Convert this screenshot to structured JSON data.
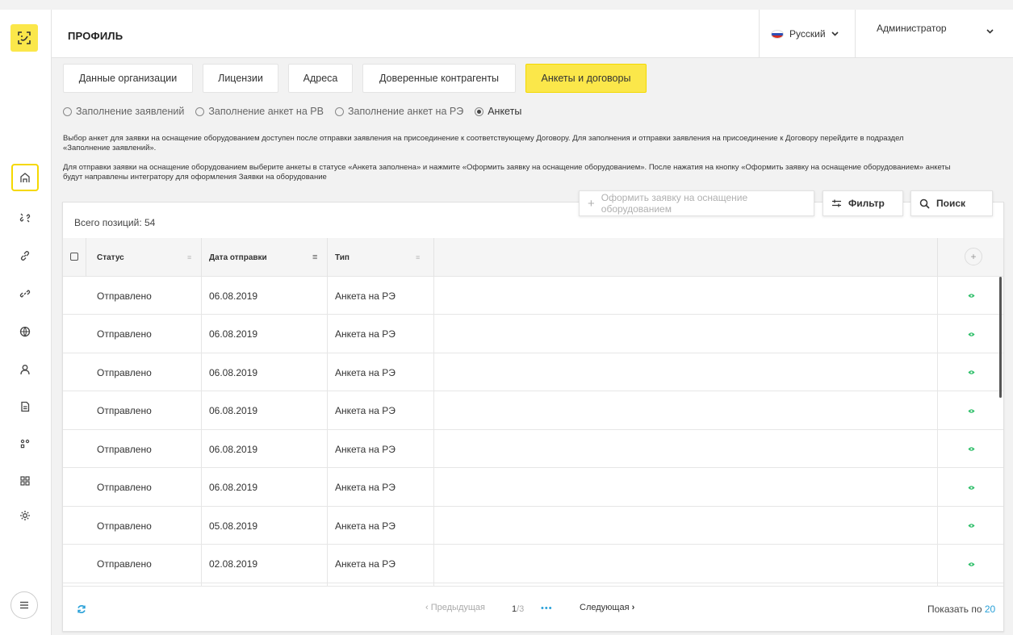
{
  "sidebar": {
    "nav": [
      {
        "name": "home-icon",
        "active": true
      },
      {
        "name": "link-broken-icon"
      },
      {
        "name": "link-icon"
      },
      {
        "name": "link-broken-2-icon"
      },
      {
        "name": "globe-icon"
      },
      {
        "name": "user-icon"
      },
      {
        "name": "document-icon"
      },
      {
        "name": "apps-icon"
      },
      {
        "name": "grid-icon"
      },
      {
        "name": "settings-icon"
      }
    ]
  },
  "header": {
    "title": "ПРОФИЛЬ",
    "language": "Русский",
    "user": "Администратор"
  },
  "tabs": [
    {
      "label": "Данные организации",
      "active": false
    },
    {
      "label": "Лицензии",
      "active": false
    },
    {
      "label": "Адреса",
      "active": false
    },
    {
      "label": "Доверенные контрагенты",
      "active": false
    },
    {
      "label": "Анкеты и договоры",
      "active": true
    }
  ],
  "radios": [
    {
      "label": "Заполнение заявлений",
      "checked": false
    },
    {
      "label": "Заполнение анкет на РВ",
      "checked": false
    },
    {
      "label": "Заполнение анкет на РЭ",
      "checked": false
    },
    {
      "label": "Анкеты",
      "checked": true
    }
  ],
  "info": {
    "line1a": "Выбор анкет для заявки на оснащение оборудованием доступен после отправки заявления на присоединение к соответствующему Договору. Для заполнения и отправки заявления на присоединение к Договору перейдите в подраздел",
    "line1b": "«Заполнение заявлений».",
    "line2a": "Для отправки заявки на оснащение оборудованием выберите анкеты в статусе «Анкета заполнена» и нажмите «Оформить заявку на оснащение оборудованием». После нажатия на кнопку «Оформить заявку на оснащение оборудованием» анкеты",
    "line2b": "будут направлены интегратору для оформления Заявки на оборудование"
  },
  "toolbar": {
    "submit_label": "Оформить заявку на оснащение оборудованием",
    "filter_label": "Фильтр",
    "search_label": "Поиск"
  },
  "table": {
    "total": "Всего позиций: 54",
    "columns": [
      "Статус",
      "Дата отправки",
      "Тип"
    ],
    "rows": [
      [
        "Отправлено",
        "06.08.2019",
        "Анкета на РЭ"
      ],
      [
        "Отправлено",
        "06.08.2019",
        "Анкета на РЭ"
      ],
      [
        "Отправлено",
        "06.08.2019",
        "Анкета на РЭ"
      ],
      [
        "Отправлено",
        "06.08.2019",
        "Анкета на РЭ"
      ],
      [
        "Отправлено",
        "06.08.2019",
        "Анкета на РЭ"
      ],
      [
        "Отправлено",
        "06.08.2019",
        "Анкета на РЭ"
      ],
      [
        "Отправлено",
        "05.08.2019",
        "Анкета на РЭ"
      ],
      [
        "Отправлено",
        "02.08.2019",
        "Анкета на РЭ"
      ]
    ]
  },
  "pagination": {
    "prev": "Предыдущая",
    "page": "1",
    "total_pages": "/3",
    "ellipsis": "•••",
    "next": "Следующая",
    "page_size_label": "Показать по",
    "page_size": "20"
  },
  "colors": {
    "accent": "#fbe74a",
    "link": "#29a0d8",
    "eye": "#2fbf6a"
  }
}
